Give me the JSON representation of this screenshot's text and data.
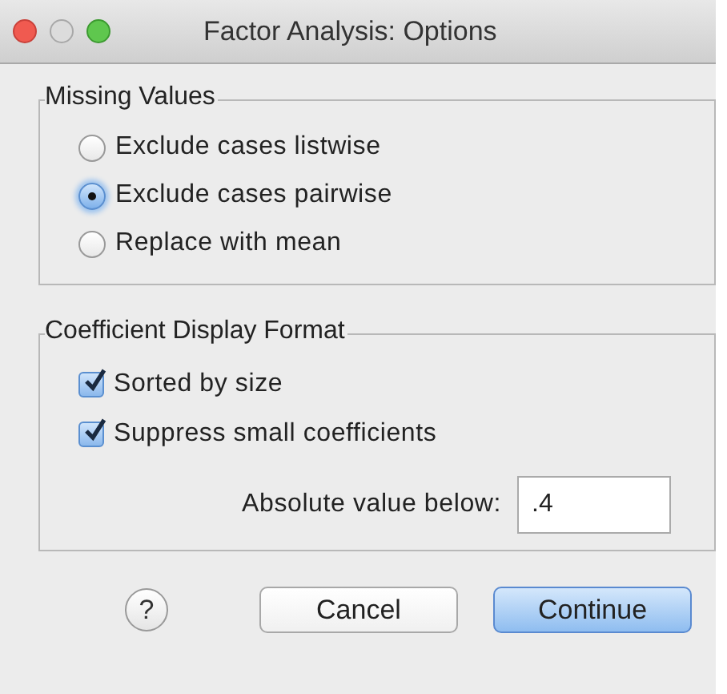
{
  "window": {
    "title": "Factor Analysis: Options"
  },
  "missing_values": {
    "title": "Missing Values",
    "options": [
      {
        "label": "Exclude cases listwise",
        "selected": false
      },
      {
        "label": "Exclude cases pairwise",
        "selected": true
      },
      {
        "label": "Replace with mean",
        "selected": false
      }
    ]
  },
  "coefficient_display_format": {
    "title": "Coefficient Display Format",
    "options": [
      {
        "label": "Sorted by size",
        "checked": true
      },
      {
        "label": "Suppress small coefficients",
        "checked": true
      }
    ],
    "threshold": {
      "label": "Absolute value below:",
      "value": ".4"
    }
  },
  "help_button": "?",
  "buttons": [
    {
      "label": "Cancel",
      "default": false
    },
    {
      "label": "Continue",
      "default": true
    }
  ]
}
